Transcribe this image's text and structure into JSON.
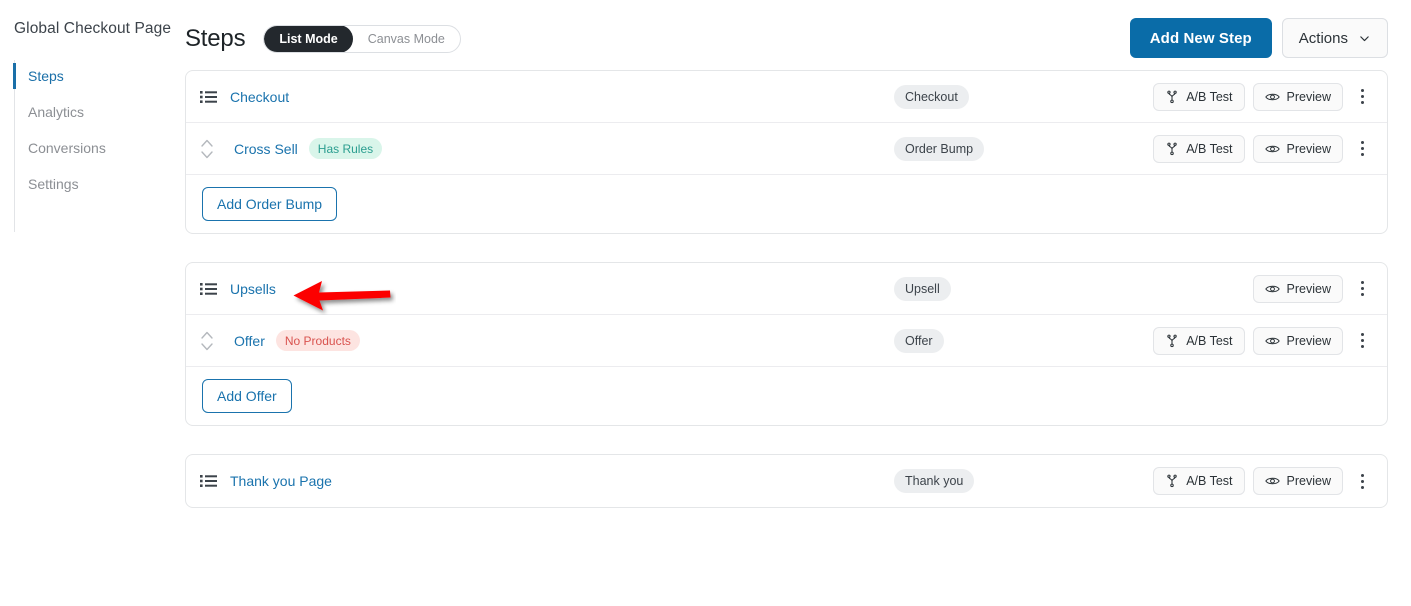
{
  "sidebar": {
    "site_title": "Global Checkout Page",
    "items": [
      {
        "label": "Steps",
        "active": true
      },
      {
        "label": "Analytics",
        "active": false
      },
      {
        "label": "Conversions",
        "active": false
      },
      {
        "label": "Settings",
        "active": false
      }
    ]
  },
  "header": {
    "page_title": "Steps",
    "mode_toggle": {
      "list_mode": "List Mode",
      "canvas_mode": "Canvas Mode",
      "selected": "List Mode"
    },
    "add_new_step": "Add New Step",
    "actions": "Actions",
    "chevron": "chevron-down-icon",
    "primary_color": "#0a6ca8"
  },
  "labels": {
    "ab_test": "A/B Test",
    "preview": "Preview",
    "menu": "more-options-icon"
  },
  "cards": [
    {
      "rows": [
        {
          "title": "Checkout",
          "handle": "list-icon",
          "badge": null,
          "type": "Checkout",
          "has_ab_test": true,
          "has_preview": true
        },
        {
          "title": "Cross Sell",
          "handle": "sort-icon",
          "badge": {
            "text": "Has Rules",
            "style": "green"
          },
          "type": "Order Bump",
          "has_ab_test": true,
          "has_preview": true
        }
      ],
      "footer_button": "Add Order Bump"
    },
    {
      "rows": [
        {
          "title": "Upsells",
          "handle": "list-icon",
          "badge": null,
          "type": "Upsell",
          "has_ab_test": false,
          "has_preview": true
        },
        {
          "title": "Offer",
          "handle": "sort-icon",
          "badge": {
            "text": "No Products",
            "style": "red"
          },
          "type": "Offer",
          "has_ab_test": true,
          "has_preview": true
        }
      ],
      "footer_button": "Add Offer"
    },
    {
      "rows": [
        {
          "title": "Thank you Page",
          "handle": "list-icon",
          "badge": null,
          "type": "Thank you",
          "has_ab_test": true,
          "has_preview": true
        }
      ],
      "footer_button": null
    }
  ],
  "annotation": {
    "type": "arrow-pointer",
    "color": "#fc0000",
    "direction": "left",
    "points_at": "Upsells"
  }
}
